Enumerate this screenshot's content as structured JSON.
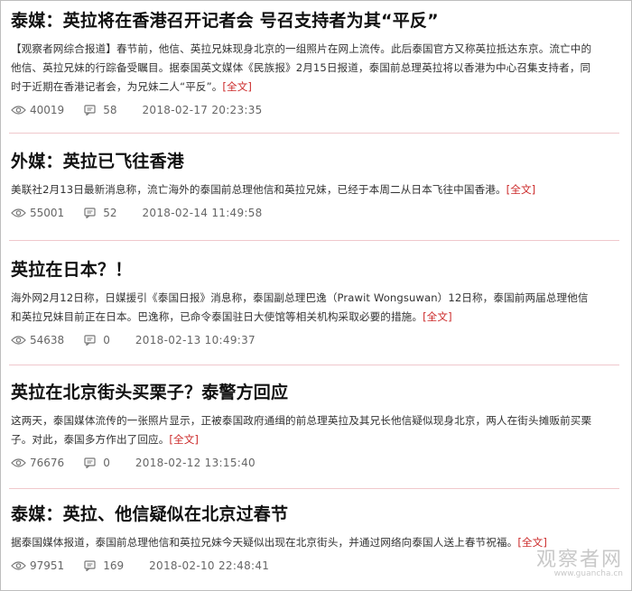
{
  "articles": [
    {
      "title": "泰媒：英拉将在香港召开记者会 号召支持者为其“平反”",
      "lines": [
        "【观察者网综合报道】春节前，他信、英拉兄妹现身北京的一组照片在网上流传。此后泰国官方又称英拉抵达东京。流亡中的",
        "他信、英拉兄妹的行踪备受瞩目。据泰国英文媒体《民族报》2月15日报道，泰国前总理英拉将以香港为中心召集支持者，同",
        "时于近期在香港记者会，为兄妹二人“平反”。"
      ],
      "more": "[全文]",
      "views": "40019",
      "comments": "58",
      "date": "2018-02-17 20:23:35"
    },
    {
      "title": "外媒：英拉已飞往香港",
      "lines": [
        "美联社2月13日最新消息称，流亡海外的泰国前总理他信和英拉兄妹，已经于本周二从日本飞往中国香港。"
      ],
      "more": "[全文]",
      "views": "55001",
      "comments": "52",
      "date": "2018-02-14 11:49:58"
    },
    {
      "title": "英拉在日本？！",
      "lines": [
        "海外网2月12日称，日媒援引《泰国日报》消息称，泰国副总理巴逸（Prawit Wongsuwan）12日称，泰国前两届总理他信",
        "和英拉兄妹目前正在日本。巴逸称，已命令泰国驻日大使馆等相关机构采取必要的措施。"
      ],
      "more": "[全文]",
      "views": "54638",
      "comments": "0",
      "date": "2018-02-13 10:49:37"
    },
    {
      "title": "英拉在北京街头买栗子？泰警方回应",
      "lines": [
        "这两天，泰国媒体流传的一张照片显示，正被泰国政府通缉的前总理英拉及其兄长他信疑似现身北京，两人在街头摊贩前买栗",
        "子。对此，泰国多方作出了回应。"
      ],
      "more": "[全文]",
      "views": "76676",
      "comments": "0",
      "date": "2018-02-12 13:15:40"
    },
    {
      "title": "泰媒：英拉、他信疑似在北京过春节",
      "lines": [
        "据泰国媒体报道，泰国前总理他信和英拉兄妹今天疑似出现在北京街头，并通过网络向泰国人送上春节祝福。"
      ],
      "more": "[全文]",
      "views": "97951",
      "comments": "169",
      "date": "2018-02-10 22:48:41"
    }
  ],
  "icons": {
    "views": "eye-icon",
    "comments": "comment-icon"
  },
  "colors": {
    "more_link": "#cc2a2a",
    "separator": "#f0c8cc",
    "meta_text": "#666666"
  },
  "watermark": {
    "text": "观察者网",
    "url": "www.guancha.cn"
  }
}
